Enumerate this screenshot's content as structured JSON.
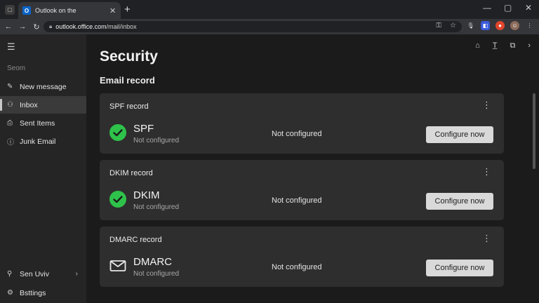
{
  "browser": {
    "tab_title": "Outlook on the",
    "tab_favicon": "O",
    "url_host": "outlook.office.com",
    "url_path": "/mail/inbox",
    "new_tab": "+",
    "close": "✕"
  },
  "sidebar": {
    "section_label": "Seom",
    "items": [
      {
        "label": "New message",
        "icon": "compose-icon"
      },
      {
        "label": "Inbox",
        "icon": "person-icon"
      },
      {
        "label": "Sent Items",
        "icon": "inbox-tray-icon"
      },
      {
        "label": "Junk Email",
        "icon": "info-icon"
      }
    ],
    "account": {
      "label": "Sen Uviv",
      "icon": "location-icon"
    },
    "settings": {
      "label": "Bsttings",
      "icon": "gear-icon"
    }
  },
  "main": {
    "page_title": "Security",
    "section_title": "Email record",
    "records": [
      {
        "card_title": "SPF record",
        "name": "SPF",
        "subtitle": "Not configured",
        "status": "Not configured",
        "button": "Configure now",
        "icon": "check-circle-icon"
      },
      {
        "card_title": "DKIM record",
        "name": "DKIM",
        "subtitle": "Not configured",
        "status": "Not configured",
        "button": "Configure now",
        "icon": "check-circle-icon"
      },
      {
        "card_title": "DMARC record",
        "name": "DMARC",
        "subtitle": "Not configured",
        "status": "Not configured",
        "button": "Configure now",
        "icon": "envelope-icon"
      }
    ]
  },
  "colors": {
    "accent_green": "#2ec24a",
    "button_bg": "#d9d9d9",
    "card_bg": "#2e2e2e"
  }
}
